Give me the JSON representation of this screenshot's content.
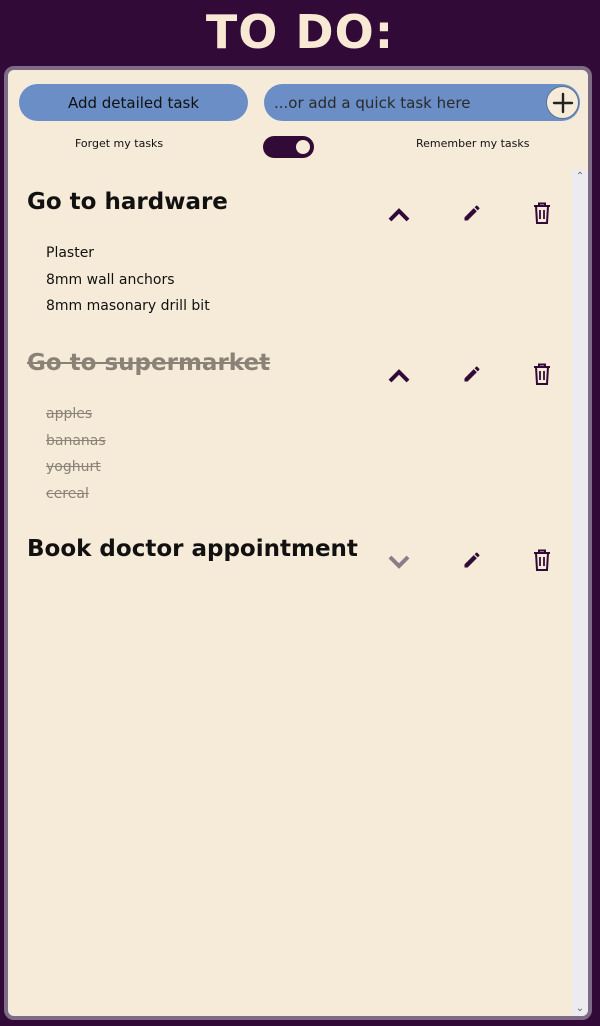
{
  "app": {
    "title": "TO DO:"
  },
  "toolbar": {
    "add_detailed_label": "Add detailed task",
    "quick_placeholder": "...or add a quick task here",
    "add_icon": "plus-icon"
  },
  "memory": {
    "forget_label": "Forget my tasks",
    "remember_label": "Remember my tasks",
    "remember_on": true
  },
  "tasks": [
    {
      "title": "Go to hardware",
      "completed": false,
      "expanded": true,
      "items": [
        "Plaster",
        "8mm wall anchors",
        "8mm masonary drill bit"
      ]
    },
    {
      "title": "Go to supermarket",
      "completed": true,
      "expanded": true,
      "items": [
        "apples",
        "bananas",
        "yoghurt",
        "cereal"
      ]
    },
    {
      "title": "Book doctor appointment",
      "completed": false,
      "expanded": false,
      "items": []
    }
  ],
  "colors": {
    "background": "#320a37",
    "panel": "#f5ebd8",
    "panel_border": "#7e6b86",
    "accent_blue": "#6b8ec7",
    "icon_dark": "#320a37",
    "completed_text": "#8a8277",
    "disabled_icon": "#8e7a8a"
  }
}
